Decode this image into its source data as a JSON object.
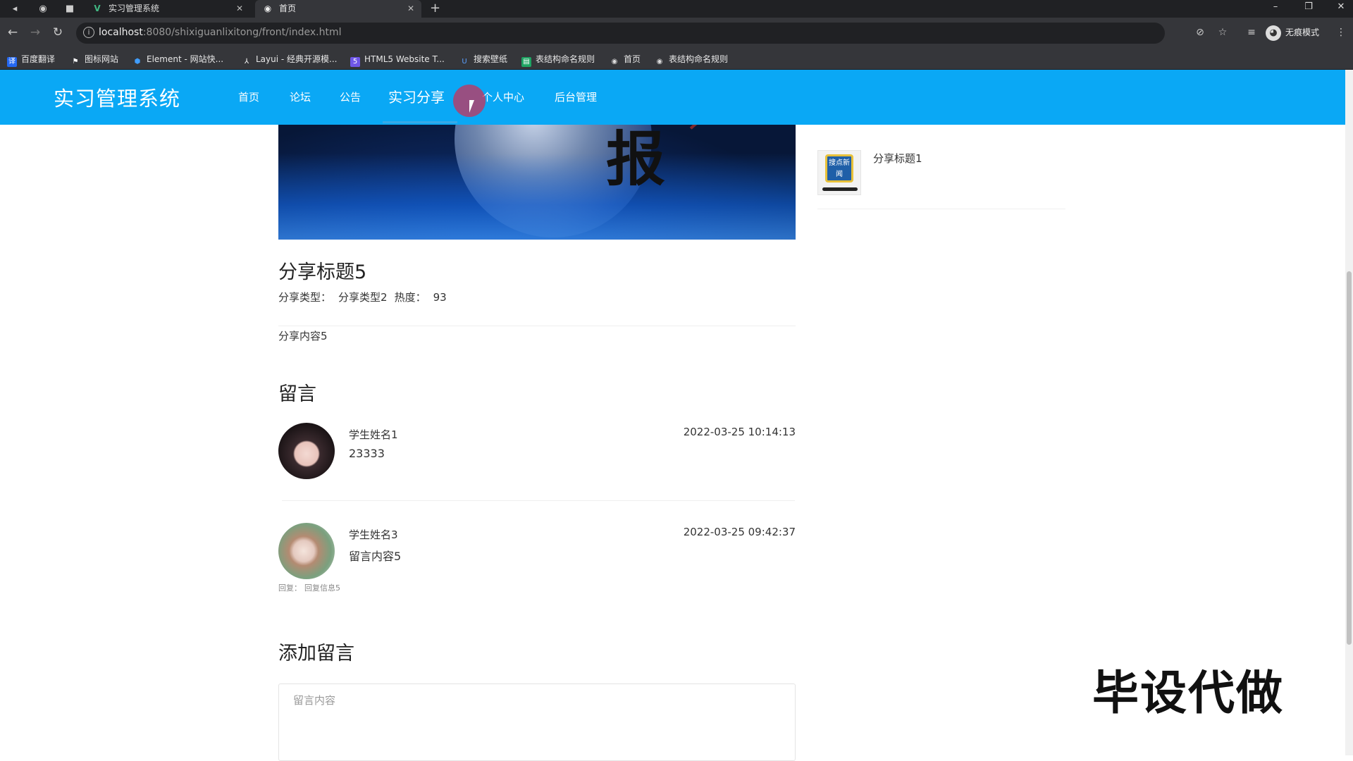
{
  "browser": {
    "tabs": [
      {
        "label": "实习管理系统",
        "icon": "vue-logo-icon",
        "active": false
      },
      {
        "label": "首页",
        "icon": "globe-icon",
        "active": true
      }
    ],
    "new_tab_symbol": "+",
    "url_host": "localhost",
    "url_rest": ":8080/shixiguanlixitong/front/index.html",
    "profile_label": "无痕模式",
    "bookmarks": [
      {
        "label": "百度翻译",
        "icon": "translate-icon",
        "color": "#2468f2"
      },
      {
        "label": "图标网站",
        "icon": "flag-icon",
        "color": "#ffffff"
      },
      {
        "label": "Element - 网站快...",
        "icon": "element-icon",
        "color": "#409eff"
      },
      {
        "label": "Layui - 经典开源模...",
        "icon": "layui-icon",
        "color": "#ffffff"
      },
      {
        "label": "HTML5 Website T...",
        "icon": "html5-icon",
        "color": "#6f57e8"
      },
      {
        "label": "搜索壁纸",
        "icon": "wallpaper-icon",
        "color": "#2b7bd8"
      },
      {
        "label": "表结构命名规则",
        "icon": "sheet-icon",
        "color": "#1fa463"
      },
      {
        "label": "首页",
        "icon": "globe-icon",
        "color": "#dddddd"
      },
      {
        "label": "表结构命名规则",
        "icon": "globe-icon",
        "color": "#dddddd"
      }
    ]
  },
  "header": {
    "logo": "实习管理系统",
    "nav": [
      {
        "label": "首页",
        "active": false
      },
      {
        "label": "论坛",
        "active": false
      },
      {
        "label": "公告",
        "active": false
      },
      {
        "label": "实习分享",
        "active": true
      },
      {
        "label": "个人中心",
        "active": false
      },
      {
        "label": "后台管理",
        "active": false
      }
    ],
    "accent_color": "#0aa8f5"
  },
  "banner": {
    "char": "报"
  },
  "post": {
    "title": "分享标题5",
    "type_label": "分享类型：",
    "type_value": "分享类型2",
    "heat_label": "热度：",
    "heat_value": "93",
    "content": "分享内容5"
  },
  "comments": {
    "title": "留言",
    "items": [
      {
        "name": "学生姓名1",
        "text": "23333",
        "time": "2022-03-25 10:14:13",
        "reply_label": "",
        "reply": ""
      },
      {
        "name": "学生姓名3",
        "text": "留言内容5",
        "time": "2022-03-25 09:42:37",
        "reply_label": "回复：",
        "reply": "回复信息5"
      }
    ]
  },
  "add_comment": {
    "title": "添加留言",
    "placeholder": "留言内容"
  },
  "sidebar": {
    "items": [
      {
        "title": "分享标题1",
        "thumb_text": "搜点新闻"
      }
    ]
  },
  "watermark": "毕设代做"
}
